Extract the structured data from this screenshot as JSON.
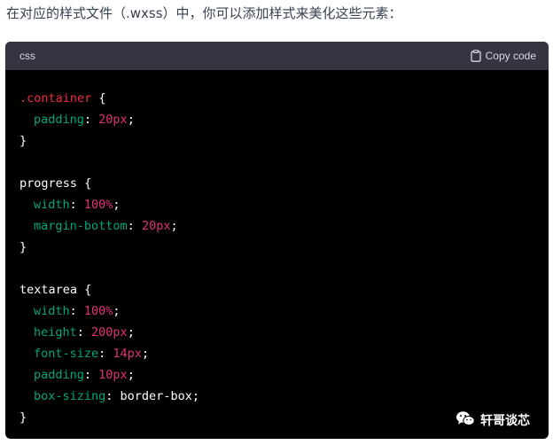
{
  "intro_text": "在对应的样式文件（.wxss）中，你可以添加样式来美化这些元素：",
  "code_block": {
    "language": "css",
    "copy_label": "Copy code",
    "lines": [
      [
        {
          "t": ".container",
          "c": "sel"
        },
        {
          "t": " {",
          "c": "plain"
        }
      ],
      [
        {
          "t": "padding",
          "c": "prop",
          "i": 1
        },
        {
          "t": ": ",
          "c": "plain"
        },
        {
          "t": "20px",
          "c": "num"
        },
        {
          "t": ";",
          "c": "plain"
        }
      ],
      [
        {
          "t": "}",
          "c": "plain"
        }
      ],
      [],
      [
        {
          "t": "progress",
          "c": "plain"
        },
        {
          "t": " {",
          "c": "plain"
        }
      ],
      [
        {
          "t": "width",
          "c": "prop",
          "i": 1
        },
        {
          "t": ": ",
          "c": "plain"
        },
        {
          "t": "100%",
          "c": "num"
        },
        {
          "t": ";",
          "c": "plain"
        }
      ],
      [
        {
          "t": "margin-bottom",
          "c": "prop",
          "i": 1
        },
        {
          "t": ": ",
          "c": "plain"
        },
        {
          "t": "20px",
          "c": "num"
        },
        {
          "t": ";",
          "c": "plain"
        }
      ],
      [
        {
          "t": "}",
          "c": "plain"
        }
      ],
      [],
      [
        {
          "t": "textarea",
          "c": "plain"
        },
        {
          "t": " {",
          "c": "plain"
        }
      ],
      [
        {
          "t": "width",
          "c": "prop",
          "i": 1
        },
        {
          "t": ": ",
          "c": "plain"
        },
        {
          "t": "100%",
          "c": "num"
        },
        {
          "t": ";",
          "c": "plain"
        }
      ],
      [
        {
          "t": "height",
          "c": "prop",
          "i": 1
        },
        {
          "t": ": ",
          "c": "plain"
        },
        {
          "t": "200px",
          "c": "num"
        },
        {
          "t": ";",
          "c": "plain"
        }
      ],
      [
        {
          "t": "font-size",
          "c": "prop",
          "i": 1
        },
        {
          "t": ": ",
          "c": "plain"
        },
        {
          "t": "14px",
          "c": "num"
        },
        {
          "t": ";",
          "c": "plain"
        }
      ],
      [
        {
          "t": "padding",
          "c": "prop",
          "i": 1
        },
        {
          "t": ": ",
          "c": "plain"
        },
        {
          "t": "10px",
          "c": "num"
        },
        {
          "t": ";",
          "c": "plain"
        }
      ],
      [
        {
          "t": "box-sizing",
          "c": "prop",
          "i": 1
        },
        {
          "t": ": ",
          "c": "plain"
        },
        {
          "t": "border-box",
          "c": "plain"
        },
        {
          "t": ";",
          "c": "plain"
        }
      ],
      [
        {
          "t": "}",
          "c": "plain"
        }
      ]
    ]
  },
  "watermark": {
    "text": "轩哥谈芯",
    "icon": "wechat-icon"
  },
  "colors": {
    "selector": "#f22c3d",
    "property": "#00a67d",
    "number": "#df3079",
    "header_bg": "#343541",
    "code_bg": "#000000"
  }
}
